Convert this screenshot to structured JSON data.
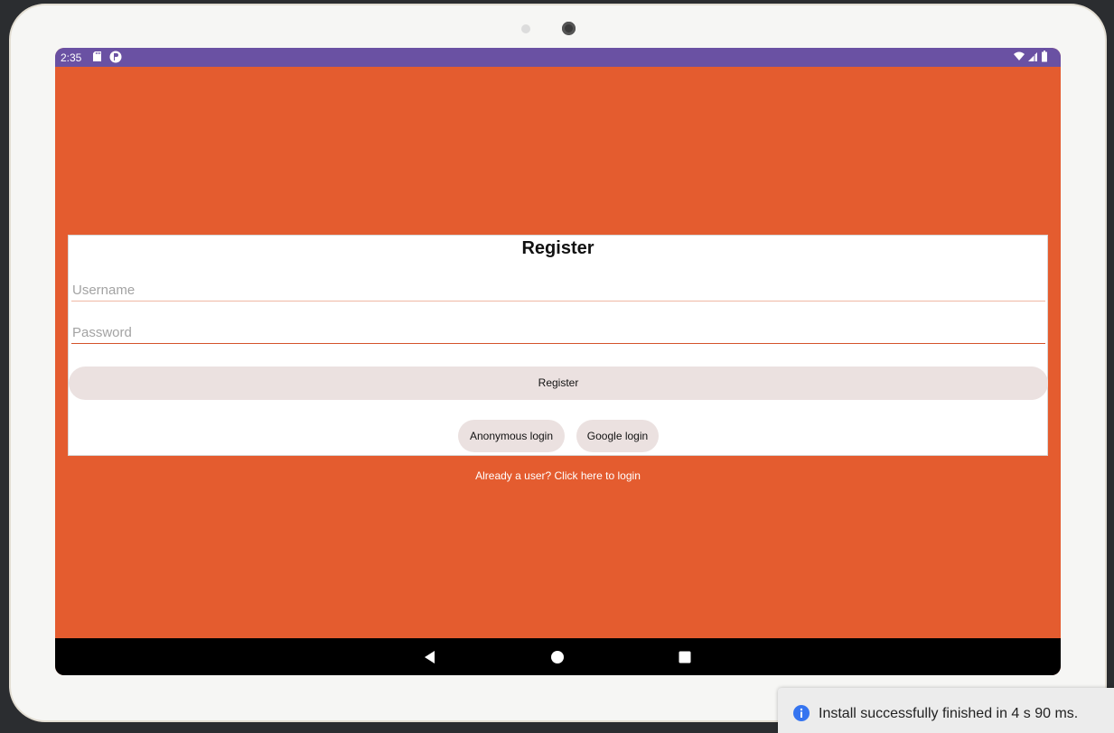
{
  "status_bar": {
    "time": "2:35",
    "icons": [
      "sd-card-icon",
      "app-notification-icon",
      "wifi-icon",
      "signal-icon",
      "battery-icon"
    ],
    "color": "#6a51a3"
  },
  "register_card": {
    "title": "Register",
    "username": {
      "value": "",
      "placeholder": "Username"
    },
    "password": {
      "value": "",
      "placeholder": "Password"
    },
    "register_button_label": "Register",
    "anonymous_login_label": "Anonymous login",
    "google_login_label": "Google login"
  },
  "login_link": "Already a user? Click here to login",
  "nav_bar": {
    "icons": [
      "back-icon",
      "home-icon",
      "recents-icon"
    ]
  },
  "toast": {
    "icon": "info-icon",
    "message": "Install successfully finished in 4 s 90 ms."
  },
  "colors": {
    "app_background": "#e45c2f",
    "status_bar": "#6a51a3",
    "button_background": "#ebe1e0",
    "info_icon": "#3574f0"
  }
}
